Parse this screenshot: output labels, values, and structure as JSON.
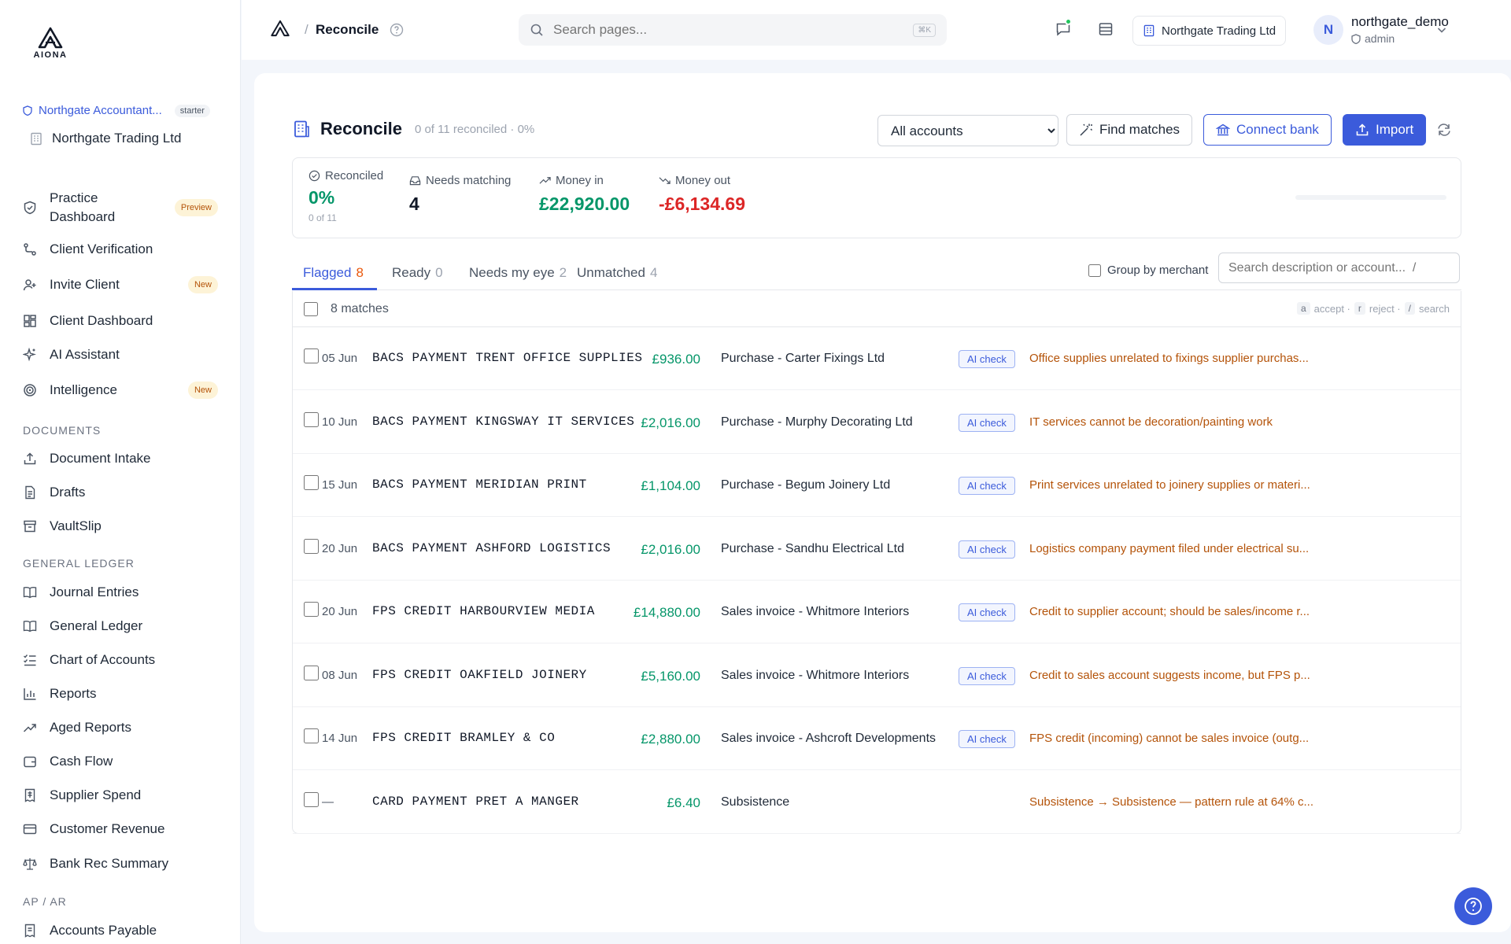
{
  "brand": {
    "logo_text": "AIONA"
  },
  "sidebar": {
    "org_name": "Northgate Accountant...",
    "org_plan": "starter",
    "client_name": "Northgate Trading Ltd",
    "items": [
      {
        "label": "Practice\nDashboard",
        "icon": "shield-check-icon",
        "pill": "Preview"
      },
      {
        "label": "Client Verification",
        "icon": "route-icon",
        "pill": ""
      },
      {
        "label": "Invite Client",
        "icon": "user-plus-icon",
        "pill": "New"
      },
      {
        "label": "Client Dashboard",
        "icon": "dashboard-icon",
        "pill": ""
      },
      {
        "label": "AI Assistant",
        "icon": "sparkles-icon",
        "pill": ""
      },
      {
        "label": "Intelligence",
        "icon": "radar-icon",
        "pill": "New"
      }
    ],
    "sections": {
      "documents": "DOCUMENTS",
      "general_ledger": "GENERAL LEDGER",
      "ap_ar": "AP / AR"
    },
    "documents_items": [
      {
        "label": "Document Intake",
        "icon": "upload-icon"
      },
      {
        "label": "Drafts",
        "icon": "file-text-icon"
      },
      {
        "label": "VaultSlip",
        "icon": "archive-icon"
      }
    ],
    "ledger_items": [
      {
        "label": "Journal Entries",
        "icon": "book-open-icon"
      },
      {
        "label": "General Ledger",
        "icon": "book-icon"
      },
      {
        "label": "Chart of Accounts",
        "icon": "list-checks-icon"
      },
      {
        "label": "Reports",
        "icon": "bar-chart-icon"
      },
      {
        "label": "Aged Reports",
        "icon": "trend-up-icon"
      },
      {
        "label": "Cash Flow",
        "icon": "wallet-icon"
      },
      {
        "label": "Supplier Spend",
        "icon": "receipt-icon"
      },
      {
        "label": "Customer Revenue",
        "icon": "credit-card-icon"
      },
      {
        "label": "Bank Rec Summary",
        "icon": "scale-icon"
      }
    ],
    "apar_items": [
      {
        "label": "Accounts Payable",
        "icon": "receipt-icon"
      }
    ]
  },
  "topbar": {
    "breadcrumb_sep": "/",
    "page": "Reconcile",
    "search_placeholder": "Search pages...",
    "search_kbd": "⌘K",
    "company": "Northgate Trading Ltd",
    "user_initial": "N",
    "user_name": "northgate_demo",
    "user_role": "admin"
  },
  "main": {
    "title": "Reconcile",
    "subtitle": "0 of 11 reconciled · 0%",
    "account_filter": "All accounts",
    "find_matches": "Find matches",
    "connect_bank": "Connect bank",
    "import": "Import",
    "stats": {
      "reconciled_label": "Reconciled",
      "reconciled_value": "0%",
      "reconciled_sub": "0 of 11",
      "needs_label": "Needs matching",
      "needs_value": "4",
      "in_label": "Money in",
      "in_value": "£22,920.00",
      "out_label": "Money out",
      "out_value": "-£6,134.69",
      "progress_fraction": 0
    },
    "tabs": [
      {
        "label": "Flagged",
        "count": "8"
      },
      {
        "label": "Ready",
        "count": "0"
      },
      {
        "label": "Needs my eye",
        "count": "2"
      },
      {
        "label": "Unmatched",
        "count": "4"
      }
    ],
    "group_by_merchant": "Group by merchant",
    "desc_search_placeholder": "Search description or account...  /",
    "matches_label": "8 matches",
    "hints": {
      "a": "a",
      "accept": "accept ·",
      "r": "r",
      "reject": "reject ·",
      "slash": "/",
      "search": "search"
    },
    "ai_check_label": "AI check",
    "rows": [
      {
        "date": "05 Jun",
        "desc": "BACS PAYMENT TRENT OFFICE SUPPLIES",
        "amount": "£936.00",
        "account": "Purchase - Carter Fixings Ltd",
        "ai": true,
        "reason": "Office supplies unrelated to fixings supplier purchas..."
      },
      {
        "date": "10 Jun",
        "desc": "BACS PAYMENT KINGSWAY IT SERVICES",
        "amount": "£2,016.00",
        "account": "Purchase - Murphy Decorating Ltd",
        "ai": true,
        "reason": "IT services cannot be decoration/painting work"
      },
      {
        "date": "15 Jun",
        "desc": "BACS PAYMENT MERIDIAN PRINT",
        "amount": "£1,104.00",
        "account": "Purchase - Begum Joinery Ltd",
        "ai": true,
        "reason": "Print services unrelated to joinery supplies or materi..."
      },
      {
        "date": "20 Jun",
        "desc": "BACS PAYMENT ASHFORD LOGISTICS",
        "amount": "£2,016.00",
        "account": "Purchase - Sandhu Electrical Ltd",
        "ai": true,
        "reason": "Logistics company payment filed under electrical su..."
      },
      {
        "date": "20 Jun",
        "desc": "FPS CREDIT HARBOURVIEW MEDIA",
        "amount": "£14,880.00",
        "account": "Sales invoice - Whitmore Interiors",
        "ai": true,
        "reason": "Credit to supplier account; should be sales/income r..."
      },
      {
        "date": "08 Jun",
        "desc": "FPS CREDIT OAKFIELD JOINERY",
        "amount": "£5,160.00",
        "account": "Sales invoice - Whitmore Interiors",
        "ai": true,
        "reason": "Credit to sales account suggests income, but FPS p..."
      },
      {
        "date": "14 Jun",
        "desc": "FPS CREDIT BRAMLEY & CO",
        "amount": "£2,880.00",
        "account": "Sales invoice - Ashcroft Developments",
        "ai": true,
        "reason": "FPS credit (incoming) cannot be sales invoice (outg..."
      },
      {
        "date": "—",
        "desc": "CARD PAYMENT PRET A MANGER",
        "amount": "£6.40",
        "account": "Subsistence",
        "ai": false,
        "reason": "Subsistence → Subsistence — pattern rule at 64% c..."
      }
    ]
  }
}
